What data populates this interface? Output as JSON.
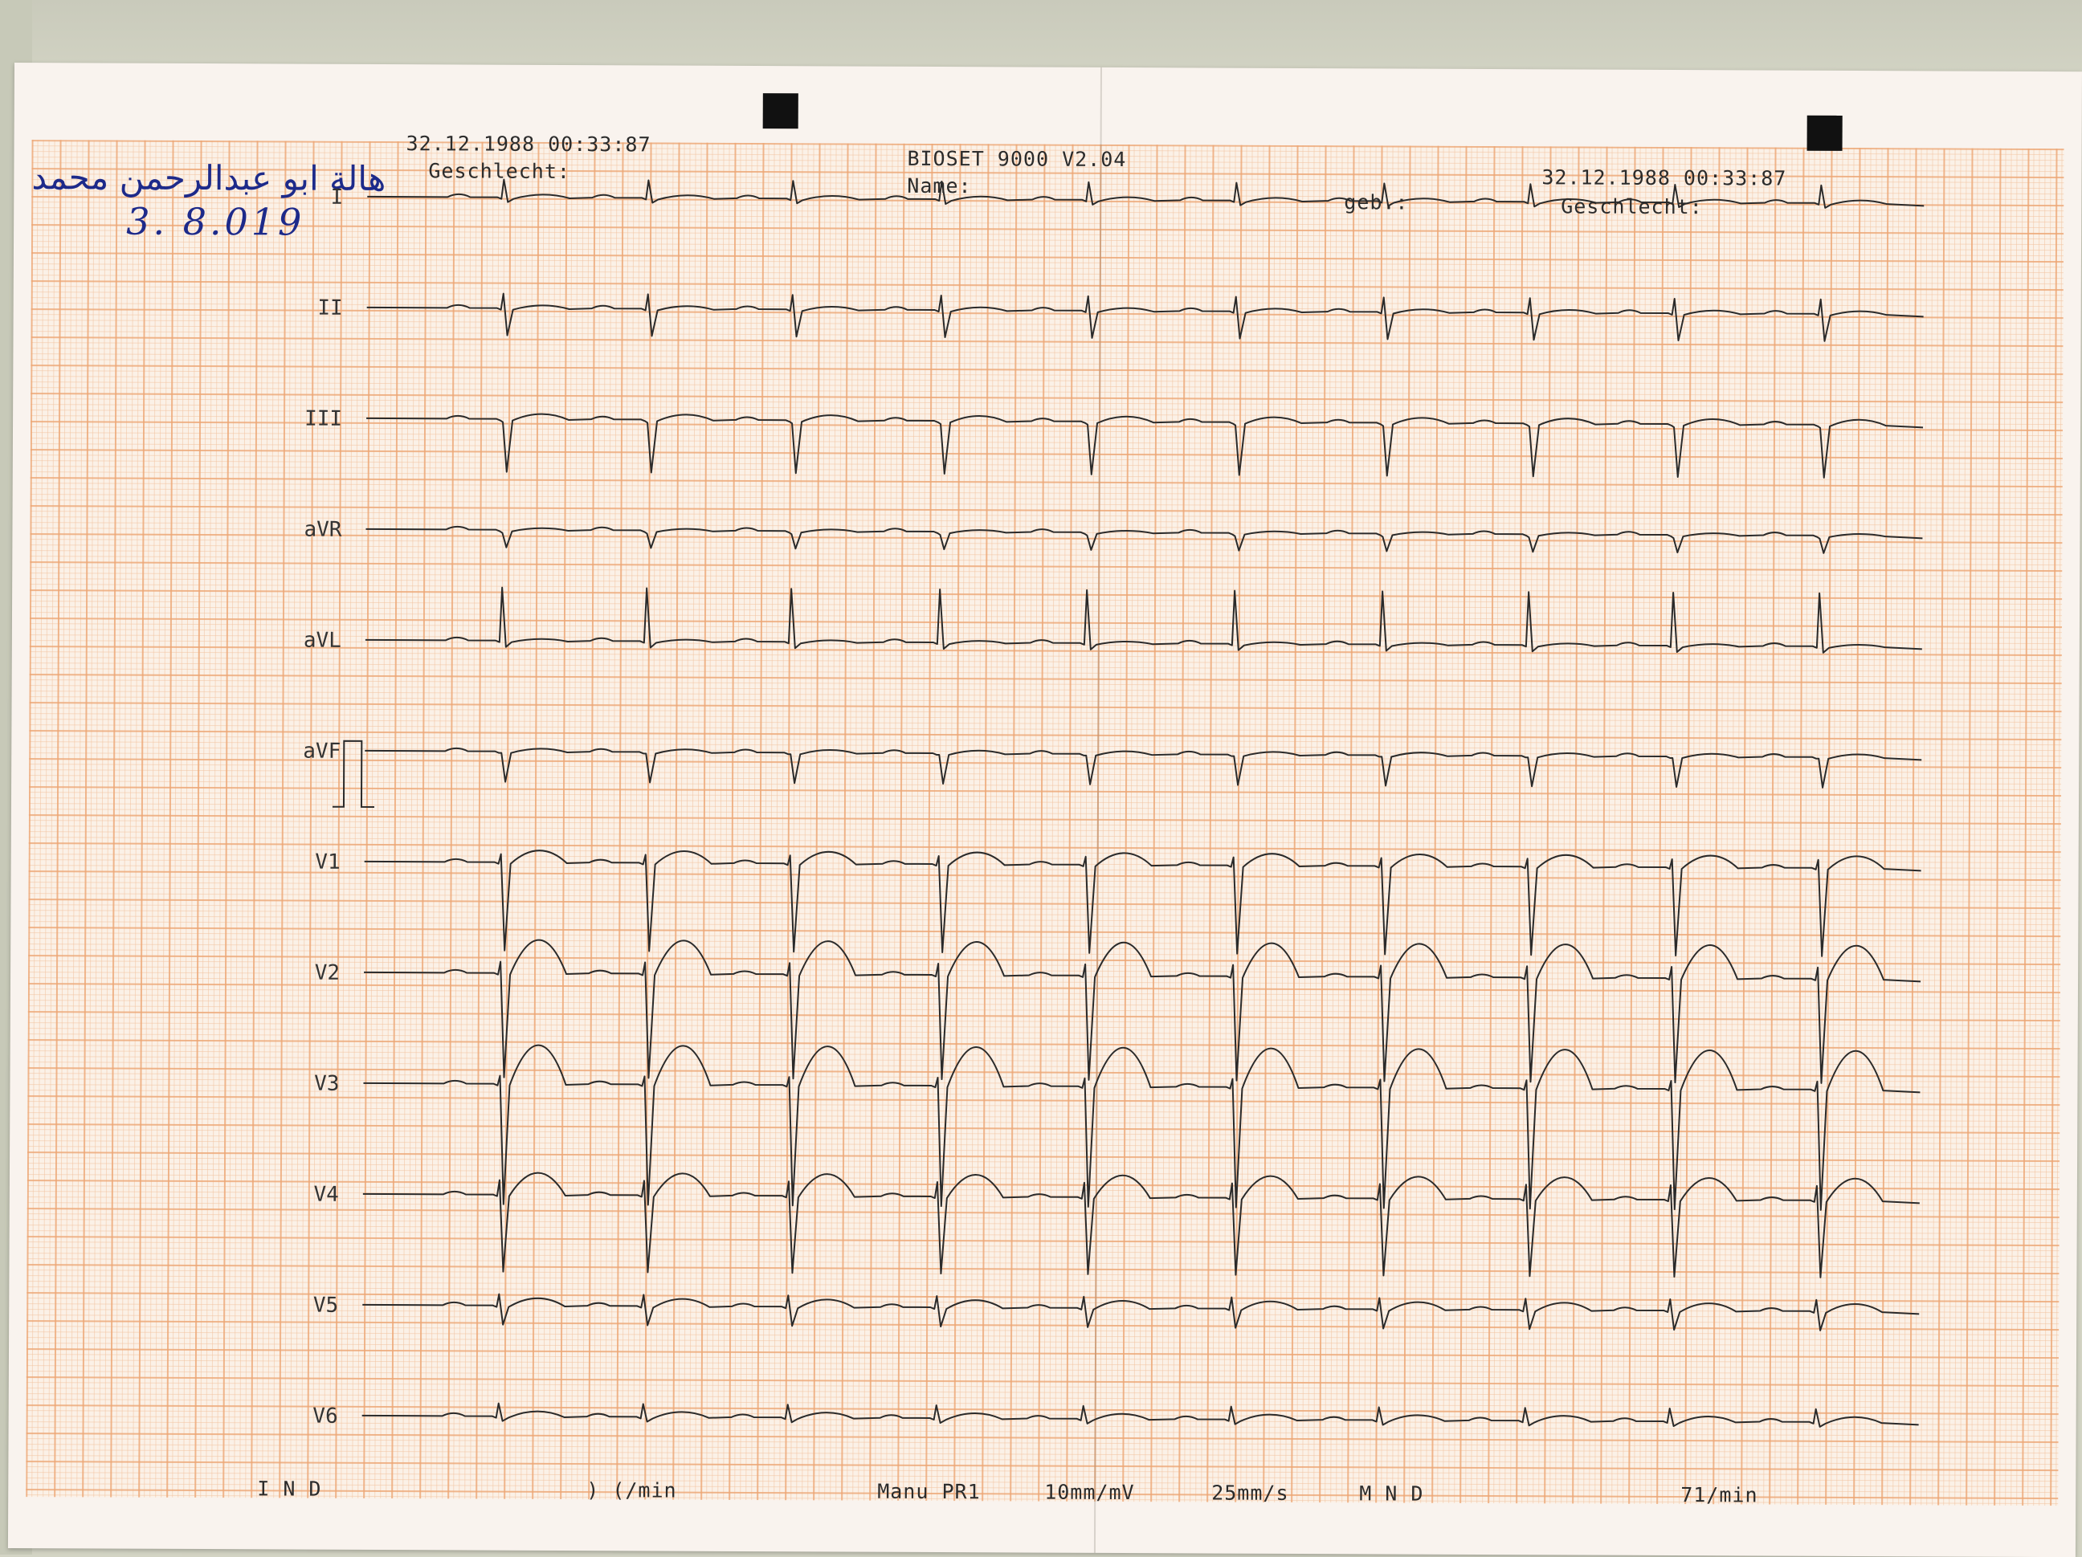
{
  "handwriting": {
    "name": "هالة ابو عبدالرحمن محمد",
    "date": "3. 8.019"
  },
  "header": {
    "datetime_left": "32.12.1988 00:33:87",
    "geschlecht_left": "Geschlecht:",
    "device": "BIOSET 9000 V2.04",
    "name_label": "Name:",
    "geb_label": "geb.:",
    "datetime_right": "32.12.1988 00:33:87",
    "geschlecht_right": "Geschlecht:"
  },
  "leads": [
    "I",
    "II",
    "III",
    "aVR",
    "aVL",
    "aVF",
    "V1",
    "V2",
    "V3",
    "V4",
    "V5",
    "V6"
  ],
  "footer": {
    "left": "I N D",
    "rate_left": ") (/min",
    "mode": "Manu PR1",
    "sensitivity": "10mm/mV",
    "speed": "25mm/s",
    "middle": "M N D",
    "rate_right": "71/min"
  },
  "colors": {
    "trace": "#2a2a2a",
    "grid_major": "#eca573",
    "grid_minor": "#f2c3a0",
    "paper": "#fbf1e7",
    "ink": "#1d2a8a"
  }
}
